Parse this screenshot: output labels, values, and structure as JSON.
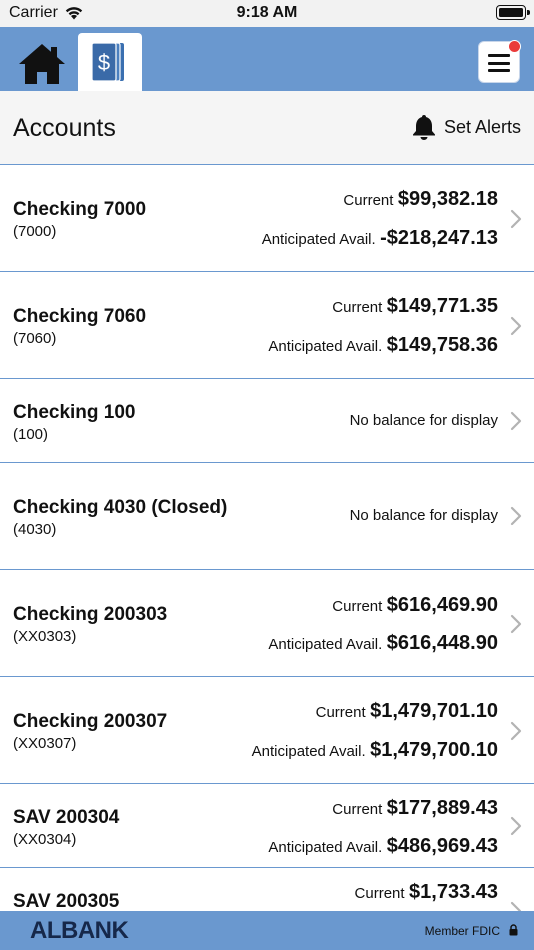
{
  "status_bar": {
    "carrier": "Carrier",
    "time": "9:18 AM",
    "wifi_icon": "wifi-icon",
    "battery_icon": "battery-icon"
  },
  "nav": {
    "home_icon": "home-icon",
    "accounts_icon": "dollar-cards-icon",
    "menu_icon": "hamburger-menu-icon",
    "notification_color": "#ea3a3a",
    "brand_color": "#6a98cf"
  },
  "header": {
    "title": "Accounts",
    "alerts_label": "Set Alerts",
    "alerts_icon": "bell-icon"
  },
  "accounts": [
    {
      "name": "Checking 7000",
      "number": "(7000)",
      "current_label": "Current",
      "current_value": "$99,382.18",
      "anticipated_label": "Anticipated Avail.",
      "anticipated_value": "-$218,247.13"
    },
    {
      "name": "Checking 7060",
      "number": "(7060)",
      "current_label": "Current",
      "current_value": "$149,771.35",
      "anticipated_label": "Anticipated Avail.",
      "anticipated_value": "$149,758.36"
    },
    {
      "name": "Checking 100",
      "number": "(100)",
      "no_balance": "No balance for display"
    },
    {
      "name": "Checking 4030 (Closed)",
      "number": "(4030)",
      "no_balance": "No balance for display"
    },
    {
      "name": "Checking 200303",
      "number": "(XX0303)",
      "current_label": "Current",
      "current_value": "$616,469.90",
      "anticipated_label": "Anticipated Avail.",
      "anticipated_value": "$616,448.90"
    },
    {
      "name": "Checking 200307",
      "number": "(XX0307)",
      "current_label": "Current",
      "current_value": "$1,479,701.10",
      "anticipated_label": "Anticipated Avail.",
      "anticipated_value": "$1,479,700.10"
    },
    {
      "name": "SAV 200304",
      "number": "(XX0304)",
      "current_label": "Current",
      "current_value": "$177,889.43",
      "anticipated_label": "Anticipated Avail.",
      "anticipated_value": "$486,969.43"
    },
    {
      "name": "SAV 200305",
      "current_label": "Current",
      "current_value": "$1,733.43"
    }
  ],
  "footer": {
    "logo": "ALBANK",
    "fdic": "Member FDIC",
    "lock_icon": "lock-icon"
  }
}
